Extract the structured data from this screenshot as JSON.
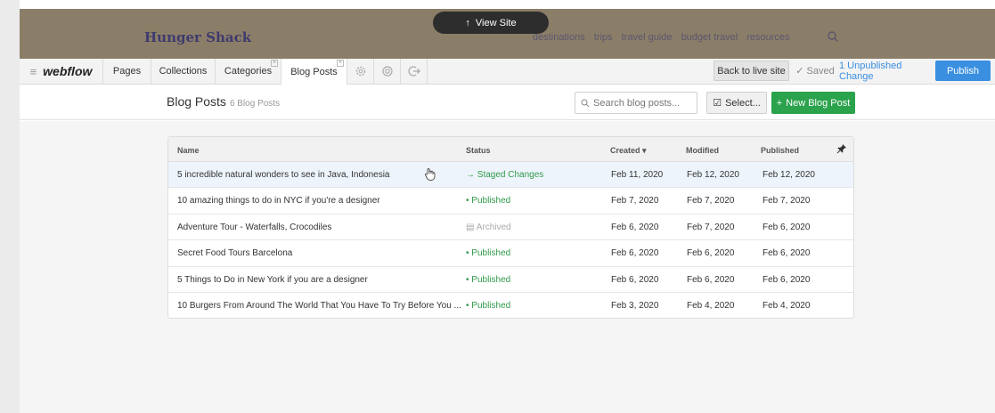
{
  "site": {
    "logo": "Hunger Shack",
    "view_site_label": "View Site",
    "nav": [
      "destinations",
      "trips",
      "travel guide",
      "budget travel",
      "resources"
    ]
  },
  "toolbar": {
    "logo": "webflow",
    "tabs": [
      "Pages",
      "Collections",
      "Categories",
      "Blog Posts"
    ],
    "back_to_live": "Back to live site",
    "saved": "Saved",
    "unpublished": "1 Unpublished Change",
    "publish": "Publish"
  },
  "collection": {
    "title": "Blog Posts",
    "count": "6 Blog Posts",
    "search_placeholder": "Search blog posts...",
    "select_label": "Select...",
    "new_label": "New Blog Post"
  },
  "table": {
    "columns": [
      "Name",
      "Status",
      "Created",
      "Modified",
      "Published"
    ],
    "rows": [
      {
        "name": "5 incredible natural wonders to see in Java, Indonesia",
        "status": "Staged Changes",
        "status_icon": "→",
        "status_kind": "staged",
        "created": "Feb 11, 2020",
        "modified": "Feb 12, 2020",
        "published": "Feb 12, 2020"
      },
      {
        "name": "10 amazing things to do in NYC if you're a designer",
        "status": "Published",
        "status_icon": "•",
        "status_kind": "published",
        "created": "Feb 7, 2020",
        "modified": "Feb 7, 2020",
        "published": "Feb 7, 2020"
      },
      {
        "name": "Adventure Tour - Waterfalls, Crocodiles",
        "status": "Archived",
        "status_icon": "▤",
        "status_kind": "archived",
        "created": "Feb 6, 2020",
        "modified": "Feb 7, 2020",
        "published": "Feb 6, 2020"
      },
      {
        "name": "Secret Food Tours Barcelona",
        "status": "Published",
        "status_icon": "•",
        "status_kind": "published",
        "created": "Feb 6, 2020",
        "modified": "Feb 6, 2020",
        "published": "Feb 6, 2020"
      },
      {
        "name": "5 Things to Do in New York if you are a designer",
        "status": "Published",
        "status_icon": "•",
        "status_kind": "published",
        "created": "Feb 6, 2020",
        "modified": "Feb 6, 2020",
        "published": "Feb 6, 2020"
      },
      {
        "name": "10 Burgers From Around The World That You Have To Try Before You ...",
        "status": "Published",
        "status_icon": "•",
        "status_kind": "published",
        "created": "Feb 3, 2020",
        "modified": "Feb 4, 2020",
        "published": "Feb 4, 2020"
      }
    ]
  },
  "colors": {
    "brand_blue": "#3a8fe0",
    "new_button_green": "#2ba24c",
    "published_green": "#2f9a4a",
    "site_header_bg": "#8b7e68"
  }
}
